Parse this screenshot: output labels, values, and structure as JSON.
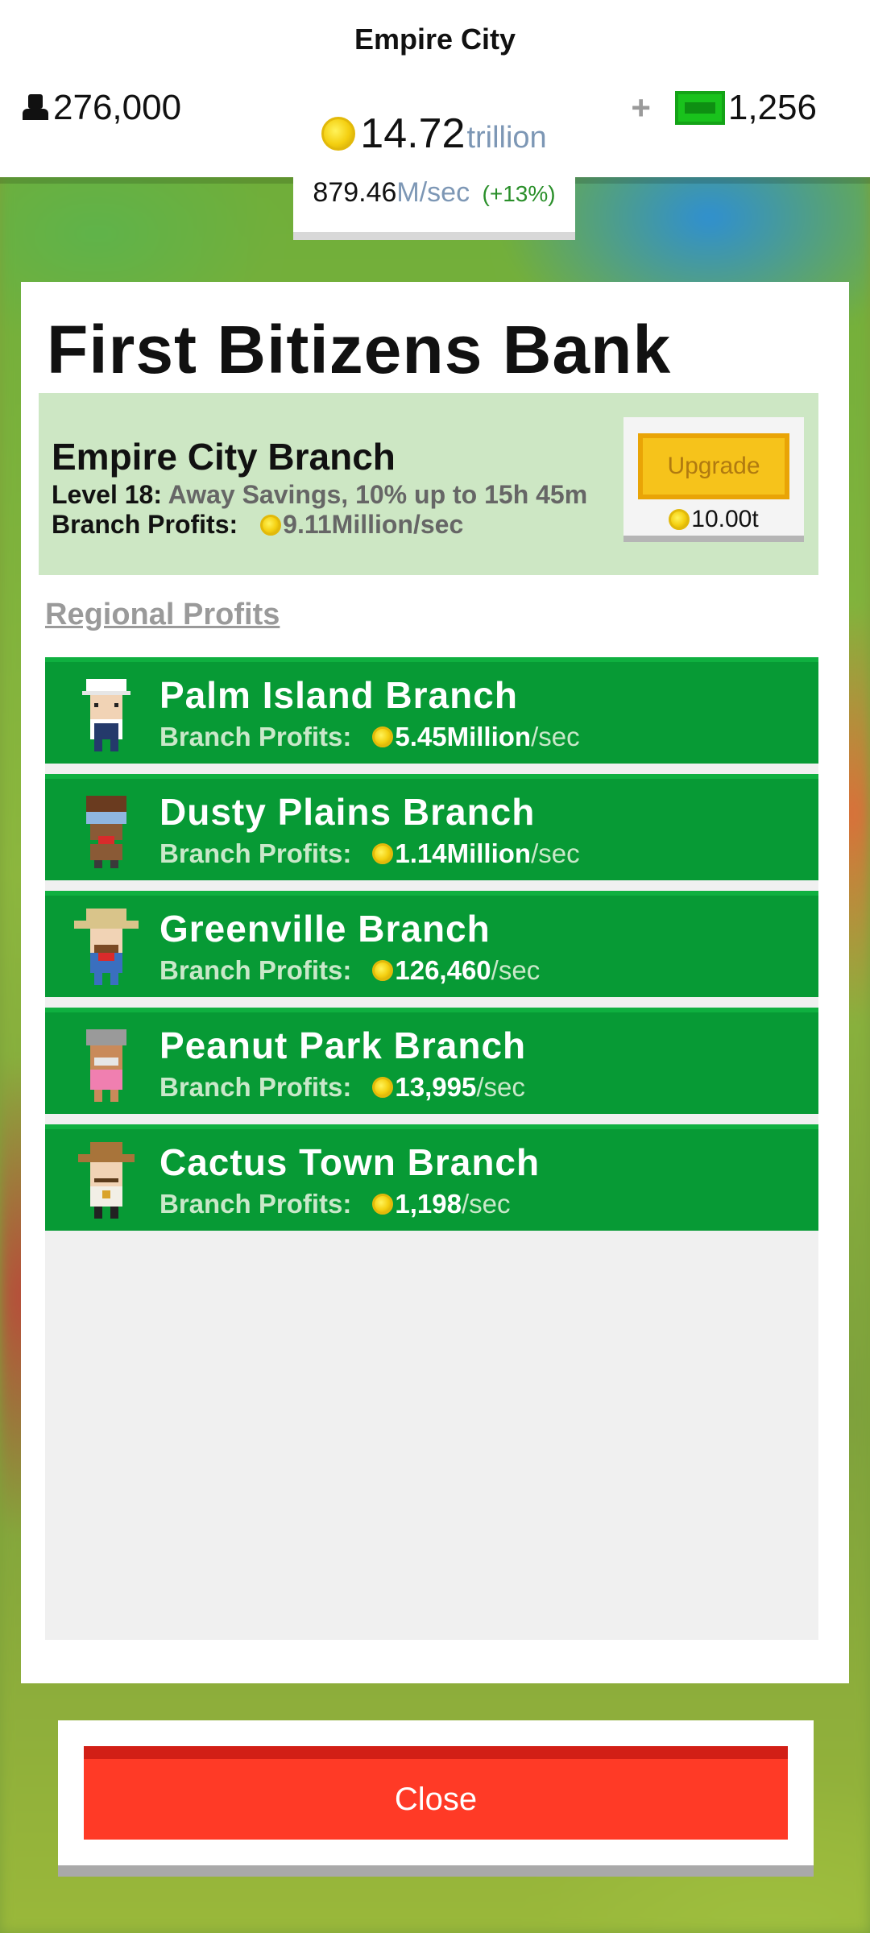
{
  "header": {
    "city_title": "Empire City",
    "population": "276,000",
    "cash_amount": "14.72",
    "cash_unit": "trillion",
    "rate_value": "879.46",
    "rate_unit_m": "M",
    "rate_unit_sec": "/sec",
    "rate_bonus": "(+13%)",
    "plus_label": "+",
    "bux_amount": "1,256"
  },
  "dialog": {
    "title": "First Bitizens Bank",
    "branch": {
      "name": "Empire City Branch",
      "level_label": "Level 18:",
      "level_desc": "Away Savings, 10% up to 15h 45m",
      "profits_label": "Branch Profits:",
      "profits_value": "9.11Million/sec",
      "upgrade_label": "Upgrade",
      "upgrade_cost": "10.00t"
    },
    "regional_heading": "Regional Profits",
    "regional": [
      {
        "name": "Palm Island Branch",
        "label": "Branch Profits:",
        "amount": "5.45Million",
        "unit": "/sec"
      },
      {
        "name": "Dusty Plains Branch",
        "label": "Branch Profits:",
        "amount": "1.14Million",
        "unit": "/sec"
      },
      {
        "name": "Greenville Branch",
        "label": "Branch Profits:",
        "amount": "126,460",
        "unit": "/sec"
      },
      {
        "name": "Peanut Park Branch",
        "label": "Branch Profits:",
        "amount": "13,995",
        "unit": "/sec"
      },
      {
        "name": "Cactus Town Branch",
        "label": "Branch Profits:",
        "amount": "1,198",
        "unit": "/sec"
      }
    ]
  },
  "close_label": "Close",
  "colors": {
    "row_green": "#079a35",
    "branch_card": "#cde7c4",
    "upgrade_yellow": "#f6c31b",
    "close_red": "#ff3a26",
    "accent_blue": "#7d97b5"
  },
  "icons": [
    "person-icon",
    "coin-icon",
    "bux-icon",
    "avatar-icon"
  ]
}
